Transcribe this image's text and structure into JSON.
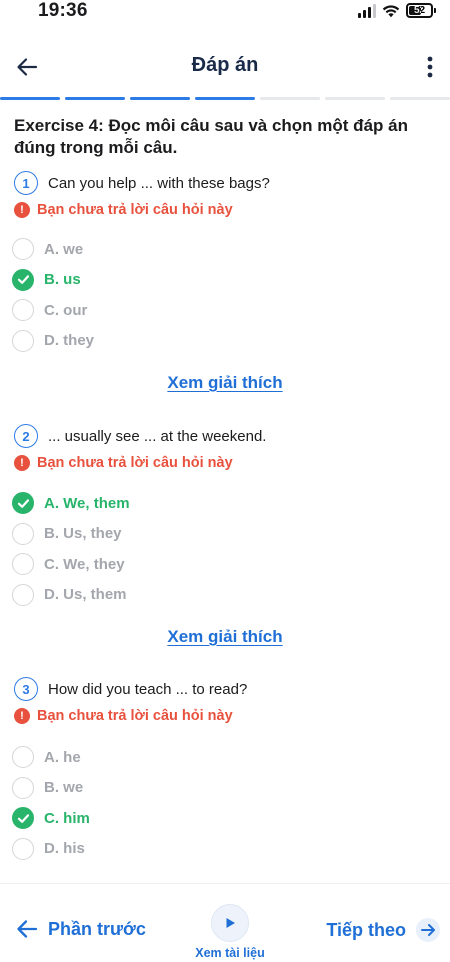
{
  "status_bar": {
    "time": "19:36",
    "battery": "52"
  },
  "header": {
    "title": "Đáp án"
  },
  "progress": {
    "segments_done": 4,
    "segments_total": 7
  },
  "exercise": {
    "title": "Exercise 4: Đọc môi câu sau và chọn một đáp án đúng trong mỗi câu."
  },
  "questions": [
    {
      "number": "1",
      "text": "Can you help ... with these bags?",
      "warning": "Bạn chưa trả lời câu hỏi này",
      "options": [
        "A. we",
        "B. us",
        "C. our",
        "D. they"
      ],
      "correct_index": 1
    },
    {
      "number": "2",
      "text": "... usually see ... at the weekend.",
      "warning": "Bạn chưa trả lời câu hỏi này",
      "options": [
        "A. We, them",
        "B. Us, they",
        "C. We, they",
        "D. Us, them"
      ],
      "correct_index": 0
    },
    {
      "number": "3",
      "text": "How did you teach ... to read?",
      "warning": "Bạn chưa trả lời câu hỏi này",
      "options": [
        "A. he",
        "B. we",
        "C. him",
        "D. his"
      ],
      "correct_index": 2
    }
  ],
  "explain_label": "Xem giải thích",
  "footer": {
    "prev_label": "Phần trước",
    "docs_label": "Xem tài liệu",
    "next_label": "Tiếp theo"
  },
  "colors": {
    "accent": "#2d7be5",
    "correct": "#28b46a",
    "warning": "#e8513d",
    "link": "#1f6fd6",
    "muted": "#a3a6ac"
  }
}
